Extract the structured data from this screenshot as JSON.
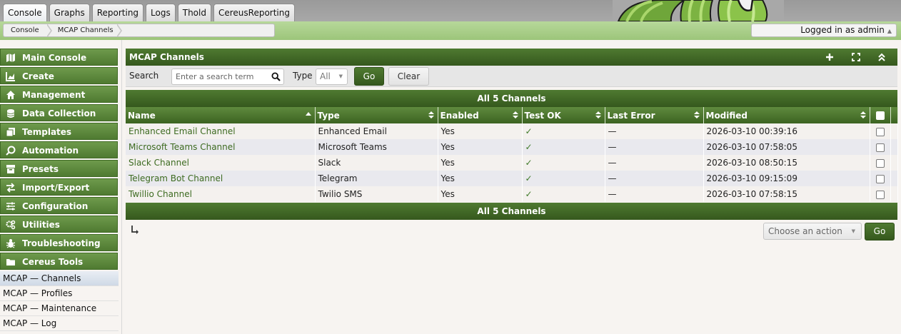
{
  "tabs": [
    {
      "label": "Console",
      "active": true
    },
    {
      "label": "Graphs"
    },
    {
      "label": "Reporting"
    },
    {
      "label": "Logs"
    },
    {
      "label": "Thold"
    },
    {
      "label": "CereusReporting"
    }
  ],
  "breadcrumb": [
    "Console",
    "MCAP Channels"
  ],
  "user": {
    "logged_in_text": "Logged in as admin"
  },
  "sidebar": {
    "items": [
      {
        "label": "Main Console",
        "icon": "map-icon"
      },
      {
        "label": "Create",
        "icon": "chart-icon"
      },
      {
        "label": "Management",
        "icon": "home-icon"
      },
      {
        "label": "Data Collection",
        "icon": "database-icon"
      },
      {
        "label": "Templates",
        "icon": "copy-icon"
      },
      {
        "label": "Automation",
        "icon": "automation-icon"
      },
      {
        "label": "Presets",
        "icon": "archive-icon"
      },
      {
        "label": "Import/Export",
        "icon": "exchange-icon"
      },
      {
        "label": "Configuration",
        "icon": "sliders-icon"
      },
      {
        "label": "Utilities",
        "icon": "cogs-icon"
      },
      {
        "label": "Troubleshooting",
        "icon": "bug-icon"
      },
      {
        "label": "Cereus Tools",
        "icon": "folder-icon"
      }
    ],
    "subitems": [
      {
        "label": "MCAP — Channels",
        "active": true
      },
      {
        "label": "MCAP — Profiles"
      },
      {
        "label": "MCAP — Maintenance"
      },
      {
        "label": "MCAP — Log"
      }
    ]
  },
  "panel": {
    "title": "MCAP Channels",
    "header_icons": [
      "plus-icon",
      "fullscreen-icon",
      "collapse-icon"
    ]
  },
  "filter": {
    "search_label": "Search",
    "search_placeholder": "Enter a search term",
    "type_label": "Type",
    "type_value": "All",
    "go_label": "Go",
    "clear_label": "Clear"
  },
  "nav_text": "All 5 Channels",
  "table": {
    "columns": [
      "Name",
      "Type",
      "Enabled",
      "Test OK",
      "Last Error",
      "Modified"
    ],
    "rows": [
      {
        "name": "Enhanced Email Channel",
        "type": "Enhanced Email",
        "enabled": "Yes",
        "test_ok": "✓",
        "last_error": "—",
        "modified": "2026-03-10 00:39:16"
      },
      {
        "name": "Microsoft Teams Channel",
        "type": "Microsoft Teams",
        "enabled": "Yes",
        "test_ok": "✓",
        "last_error": "—",
        "modified": "2026-03-10 07:58:05"
      },
      {
        "name": "Slack Channel",
        "type": "Slack",
        "enabled": "Yes",
        "test_ok": "✓",
        "last_error": "—",
        "modified": "2026-03-10 08:50:15"
      },
      {
        "name": "Telegram Bot Channel",
        "type": "Telegram",
        "enabled": "Yes",
        "test_ok": "✓",
        "last_error": "—",
        "modified": "2026-03-10 09:15:09"
      },
      {
        "name": "Twillio Channel",
        "type": "Twilio SMS",
        "enabled": "Yes",
        "test_ok": "✓",
        "last_error": "—",
        "modified": "2026-03-10 07:58:15"
      }
    ]
  },
  "actions": {
    "select_placeholder": "Choose an action",
    "go_label": "Go"
  },
  "colors": {
    "accent": "#4f7a31",
    "header_dark": "#35581d",
    "link": "#3d6b21"
  }
}
